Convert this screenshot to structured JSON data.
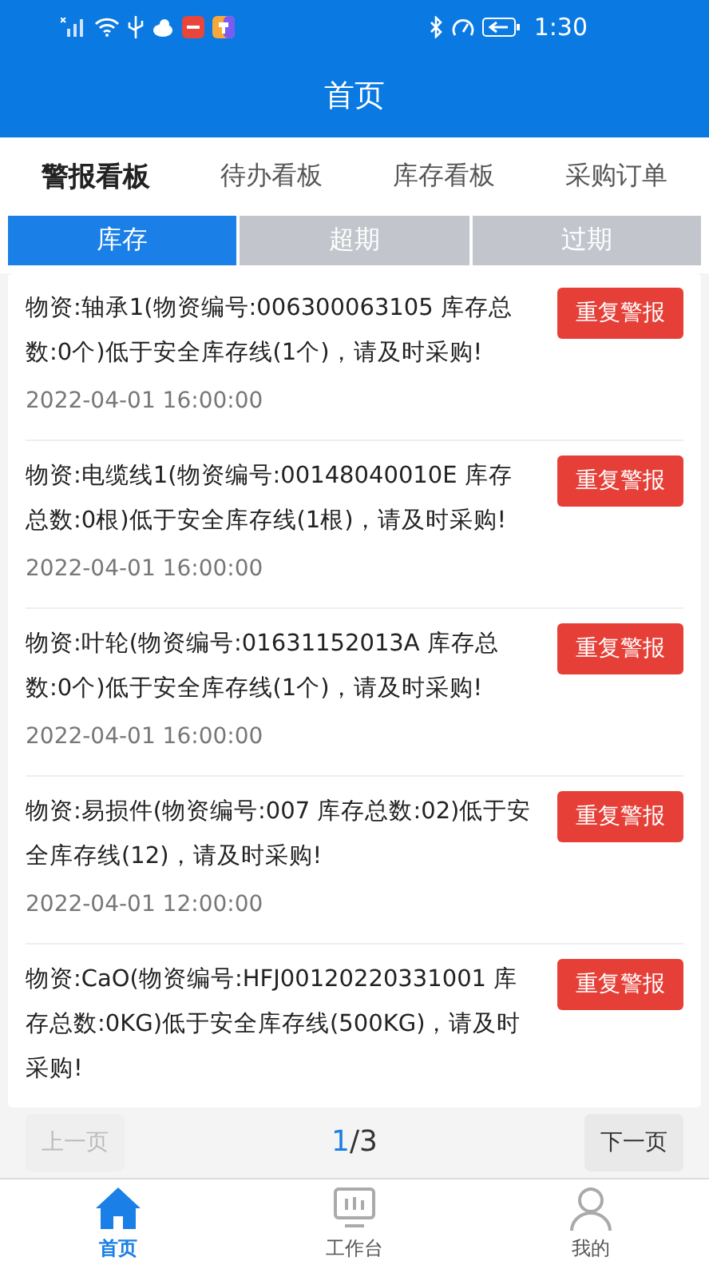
{
  "status_bar": {
    "time": "1:30"
  },
  "header": {
    "title": "首页"
  },
  "tabs": [
    {
      "label": "警报看板",
      "selected": true
    },
    {
      "label": "待办看板",
      "selected": false
    },
    {
      "label": "库存看板",
      "selected": false
    },
    {
      "label": "采购订单",
      "selected": false
    }
  ],
  "sub_tabs": [
    {
      "label": "库存",
      "selected": true
    },
    {
      "label": "超期",
      "selected": false
    },
    {
      "label": "过期",
      "selected": false
    }
  ],
  "alerts": [
    {
      "message": "物资:轴承1(物资编号:006300063105 库存总数:0个)低于安全库存线(1个)，请及时采购!",
      "time": "2022-04-01 16:00:00",
      "button": "重复警报"
    },
    {
      "message": "物资:电缆线1(物资编号:00148040010E 库存总数:0根)低于安全库存线(1根)，请及时采购!",
      "time": "2022-04-01 16:00:00",
      "button": "重复警报"
    },
    {
      "message": "物资:叶轮(物资编号:01631152013A 库存总数:0个)低于安全库存线(1个)，请及时采购!",
      "time": "2022-04-01 16:00:00",
      "button": "重复警报"
    },
    {
      "message": "物资:易损件(物资编号:007 库存总数:02)低于安全库存线(12)，请及时采购!",
      "time": "2022-04-01 12:00:00",
      "button": "重复警报"
    },
    {
      "message": "物资:CaO(物资编号:HFJ00120220331001 库存总数:0KG)低于安全库存线(500KG)，请及时采购!",
      "button": "重复警报"
    }
  ],
  "pager": {
    "prev": {
      "label": "上一页",
      "disabled": true
    },
    "current": "1",
    "total": "/3",
    "next": {
      "label": "下一页",
      "disabled": false
    }
  },
  "bottom_nav": [
    {
      "label": "首页",
      "kind": "home",
      "selected": true
    },
    {
      "label": "工作台",
      "kind": "workbench",
      "selected": false
    },
    {
      "label": "我的",
      "kind": "profile",
      "selected": false
    }
  ]
}
